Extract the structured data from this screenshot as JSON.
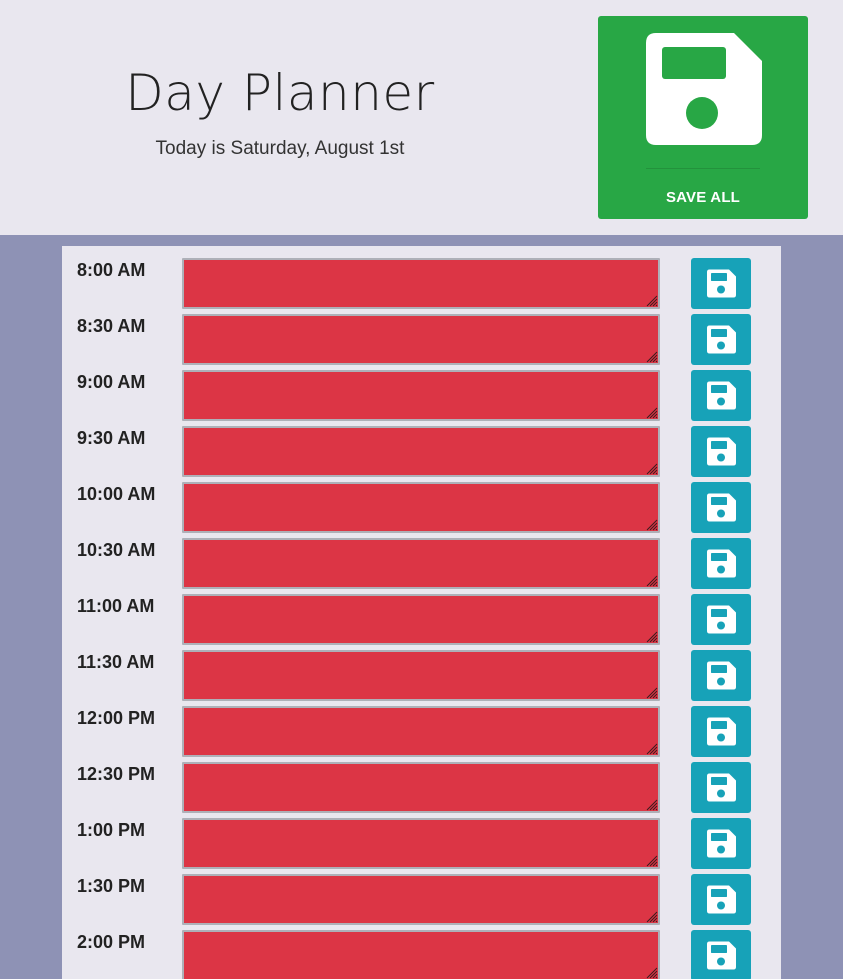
{
  "header": {
    "title": "Day Planner",
    "subtitle": "Today is Saturday, August 1st",
    "save_all_label": "SAVE ALL",
    "save_all_icon": "floppy-disk-icon"
  },
  "colors": {
    "past_block": "#dc3545",
    "save_all_bg": "#28a745",
    "save_btn_bg": "#17a2b8",
    "page_bg": "#8e92b5",
    "panel_bg": "#e9e7ef"
  },
  "schedule": [
    {
      "time": "8:00 AM",
      "note": ""
    },
    {
      "time": "8:30 AM",
      "note": ""
    },
    {
      "time": "9:00 AM",
      "note": ""
    },
    {
      "time": "9:30 AM",
      "note": ""
    },
    {
      "time": "10:00 AM",
      "note": ""
    },
    {
      "time": "10:30 AM",
      "note": ""
    },
    {
      "time": "11:00 AM",
      "note": ""
    },
    {
      "time": "11:30 AM",
      "note": ""
    },
    {
      "time": "12:00 PM",
      "note": ""
    },
    {
      "time": "12:30 PM",
      "note": ""
    },
    {
      "time": "1:00 PM",
      "note": ""
    },
    {
      "time": "1:30 PM",
      "note": ""
    },
    {
      "time": "2:00 PM",
      "note": ""
    }
  ],
  "row_save_icon": "floppy-disk-icon"
}
